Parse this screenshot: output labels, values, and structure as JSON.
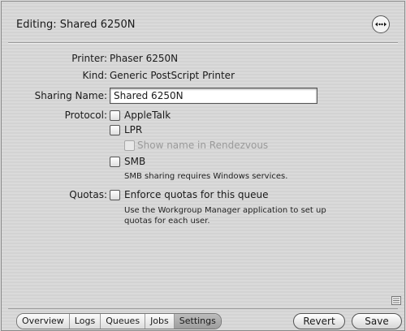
{
  "header": {
    "title": "Editing: Shared 6250N",
    "action_icon": "ellipsis-arrows-icon"
  },
  "form": {
    "printer_label": "Printer:",
    "printer_value": "Phaser 6250N",
    "kind_label": "Kind:",
    "kind_value": "Generic PostScript Printer",
    "sharing_name_label": "Sharing Name:",
    "sharing_name_value": "Shared 6250N",
    "protocol_label": "Protocol:",
    "protocols": {
      "appletalk": {
        "label": "AppleTalk",
        "checked": false
      },
      "lpr": {
        "label": "LPR",
        "checked": false
      },
      "rendezvous": {
        "label": "Show name in Rendezvous",
        "checked": false,
        "disabled": true
      },
      "smb": {
        "label": "SMB",
        "checked": false
      }
    },
    "smb_note": "SMB sharing requires Windows services.",
    "quotas_label": "Quotas:",
    "enforce_quotas": {
      "label": "Enforce quotas for this queue",
      "checked": false
    },
    "quota_note_line1": "Use the Workgroup Manager application to set up",
    "quota_note_line2": "quotas for each user."
  },
  "tabs": [
    {
      "label": "Overview",
      "selected": false
    },
    {
      "label": "Logs",
      "selected": false
    },
    {
      "label": "Queues",
      "selected": false
    },
    {
      "label": "Jobs",
      "selected": false
    },
    {
      "label": "Settings",
      "selected": true
    }
  ],
  "buttons": {
    "revert": "Revert",
    "save": "Save"
  }
}
